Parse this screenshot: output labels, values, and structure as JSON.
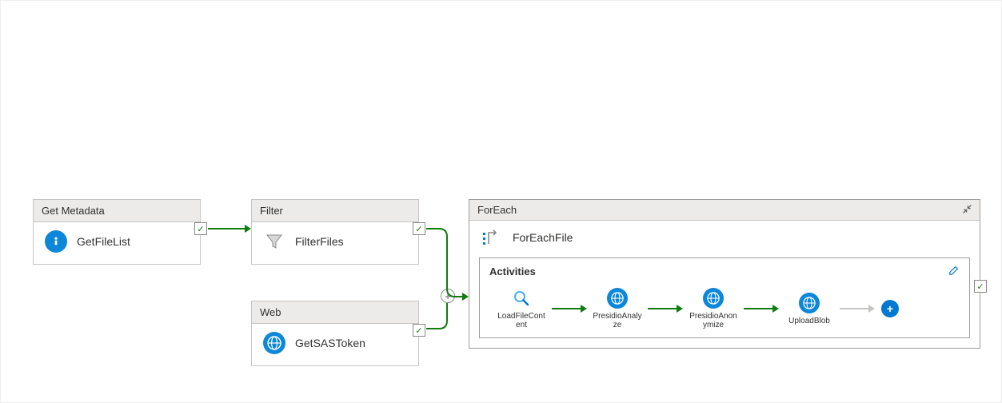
{
  "nodes": {
    "getMetadata": {
      "header": "Get Metadata",
      "name": "GetFileList"
    },
    "filter": {
      "header": "Filter",
      "name": "FilterFiles"
    },
    "web": {
      "header": "Web",
      "name": "GetSASToken"
    },
    "forEach": {
      "header": "ForEach",
      "name": "ForEachFile"
    }
  },
  "activities": {
    "sectionLabel": "Activities",
    "items": [
      {
        "label": "LoadFileContent",
        "icon": "search"
      },
      {
        "label": "PresidioAnalyze",
        "icon": "globe"
      },
      {
        "label": "PresidioAnonymize",
        "icon": "globe"
      },
      {
        "label": "UploadBlob",
        "icon": "globe"
      }
    ]
  },
  "status": {
    "success": "✓"
  },
  "buttons": {
    "add": "+"
  }
}
